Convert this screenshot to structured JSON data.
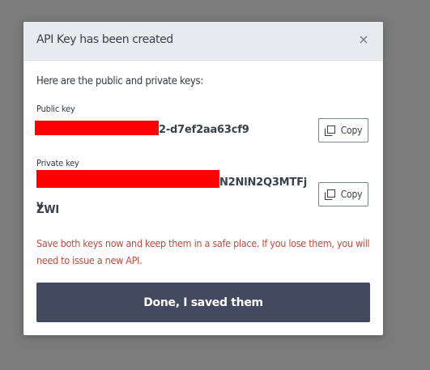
{
  "dialog": {
    "title": "API Key has been created",
    "close_symbol": "×",
    "intro": "Here are the public and private keys:",
    "public_key": {
      "label": "Public key",
      "visible_value": "2-d7ef2aa63cf9",
      "redacted": true
    },
    "private_key": {
      "label": "Private key",
      "visible_value": "N2NlN2Q3MTFjZWI",
      "visible_value_line2": "y",
      "redacted": true
    },
    "copy_label": "Copy",
    "warning": "Save both keys now and keep them in a safe place. If you lose them, you will need to issue a new API.",
    "done_label": "Done, I saved them"
  },
  "colors": {
    "overlay": "#7b7b7b",
    "header_bg": "#e8eaee",
    "primary_button": "#434a5f",
    "warning_text": "#c04a41",
    "redaction": "#ff0000"
  },
  "icons": {
    "close": "close-icon",
    "copy": "copy-icon"
  }
}
